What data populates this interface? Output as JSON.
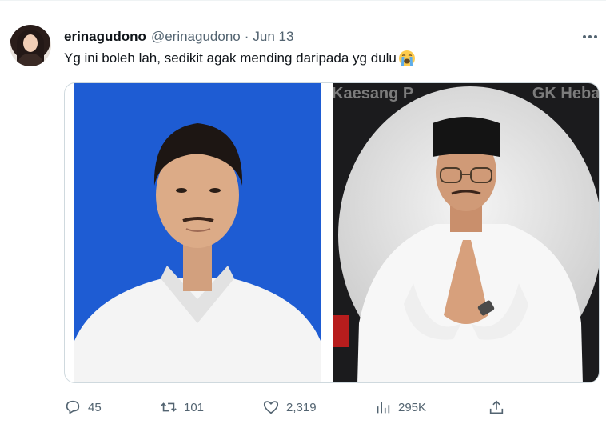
{
  "tweet": {
    "author_name": "erinagudono",
    "author_handle": "@erinagudono",
    "separator": "·",
    "date": "Jun 13",
    "text": "Yg ini boleh lah, sedikit agak mending daripada yg dulu",
    "emoji_icon": "loudly-crying-face-icon"
  },
  "media": {
    "right_photo_banner_left": "Kaesang P",
    "right_photo_banner_right": "GK Hebat"
  },
  "actions": {
    "replies": "45",
    "retweets": "101",
    "likes": "2,319",
    "views": "295K"
  },
  "colors": {
    "left_photo_background": "#1e5cd3",
    "muted_text": "#536471"
  }
}
